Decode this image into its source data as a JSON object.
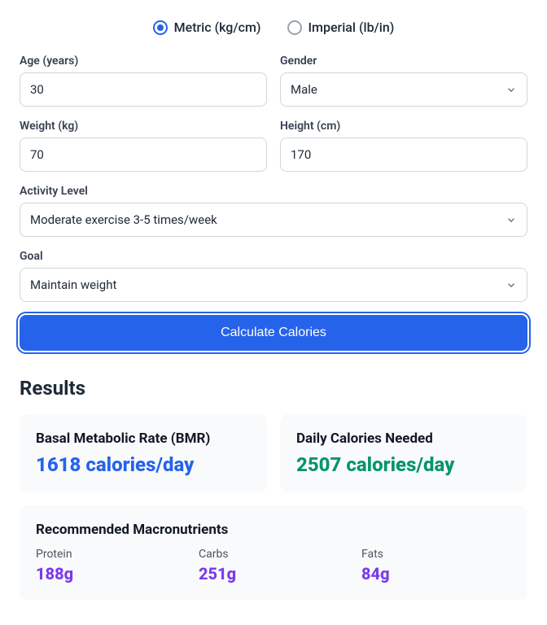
{
  "units": {
    "metric_label": "Metric (kg/cm)",
    "imperial_label": "Imperial (lb/in)"
  },
  "form": {
    "age_label": "Age (years)",
    "age_value": "30",
    "gender_label": "Gender",
    "gender_value": "Male",
    "weight_label": "Weight (kg)",
    "weight_value": "70",
    "height_label": "Height (cm)",
    "height_value": "170",
    "activity_label": "Activity Level",
    "activity_value": "Moderate exercise 3-5 times/week",
    "goal_label": "Goal",
    "goal_value": "Maintain weight",
    "calculate_label": "Calculate Calories"
  },
  "results": {
    "heading": "Results",
    "bmr_title": "Basal Metabolic Rate (BMR)",
    "bmr_value": "1618 calories/day",
    "daily_title": "Daily Calories Needed",
    "daily_value": "2507 calories/day",
    "macros_title": "Recommended Macronutrients",
    "protein_label": "Protein",
    "protein_value": "188g",
    "carbs_label": "Carbs",
    "carbs_value": "251g",
    "fats_label": "Fats",
    "fats_value": "84g"
  }
}
